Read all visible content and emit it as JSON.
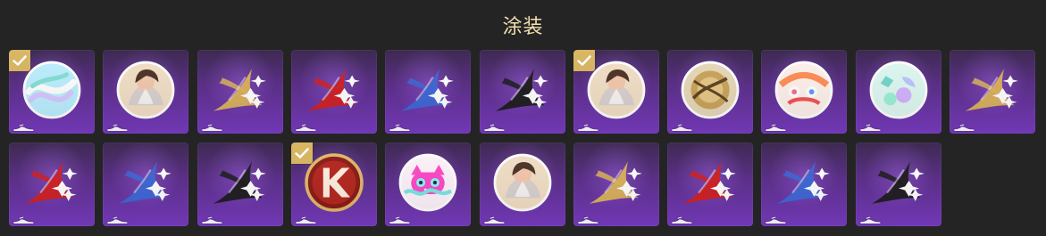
{
  "header": {
    "title": "涂装"
  },
  "colors": {
    "background": "#242424",
    "title": "#f3dfae",
    "tile_purple": "#7a3cc4",
    "selected_check": "#d8b560",
    "gold": "#ddb55a",
    "red": "#d32020",
    "blue": "#3d68d8",
    "black": "#1b1b1b"
  },
  "skins": [
    {
      "icon": "holographic-badge-icon",
      "selected": true
    },
    {
      "icon": "character-portrait-icon",
      "selected": false
    },
    {
      "icon": "gold-star-decal-icon",
      "selected": false
    },
    {
      "icon": "red-star-decal-icon",
      "selected": false
    },
    {
      "icon": "blue-star-decal-icon",
      "selected": false
    },
    {
      "icon": "black-star-decal-icon",
      "selected": false
    },
    {
      "icon": "character-portrait-icon",
      "selected": true
    },
    {
      "icon": "golden-emblem-icon",
      "selected": false
    },
    {
      "icon": "cartoon-sticker-icon",
      "selected": false
    },
    {
      "icon": "pastel-sticker-icon",
      "selected": false
    },
    {
      "icon": "gold-star-decal-icon",
      "selected": false
    },
    {
      "icon": "red-star-decal-icon",
      "selected": false
    },
    {
      "icon": "blue-star-decal-icon",
      "selected": false
    },
    {
      "icon": "black-star-decal-icon",
      "selected": false
    },
    {
      "icon": "k-emblem-icon",
      "selected": true
    },
    {
      "icon": "cat-sticker-icon",
      "selected": false
    },
    {
      "icon": "character-portrait-icon",
      "selected": false
    },
    {
      "icon": "gold-star-decal-icon",
      "selected": false
    },
    {
      "icon": "red-star-decal-icon",
      "selected": false
    },
    {
      "icon": "blue-star-decal-icon",
      "selected": false
    },
    {
      "icon": "black-star-decal-icon",
      "selected": false
    }
  ]
}
